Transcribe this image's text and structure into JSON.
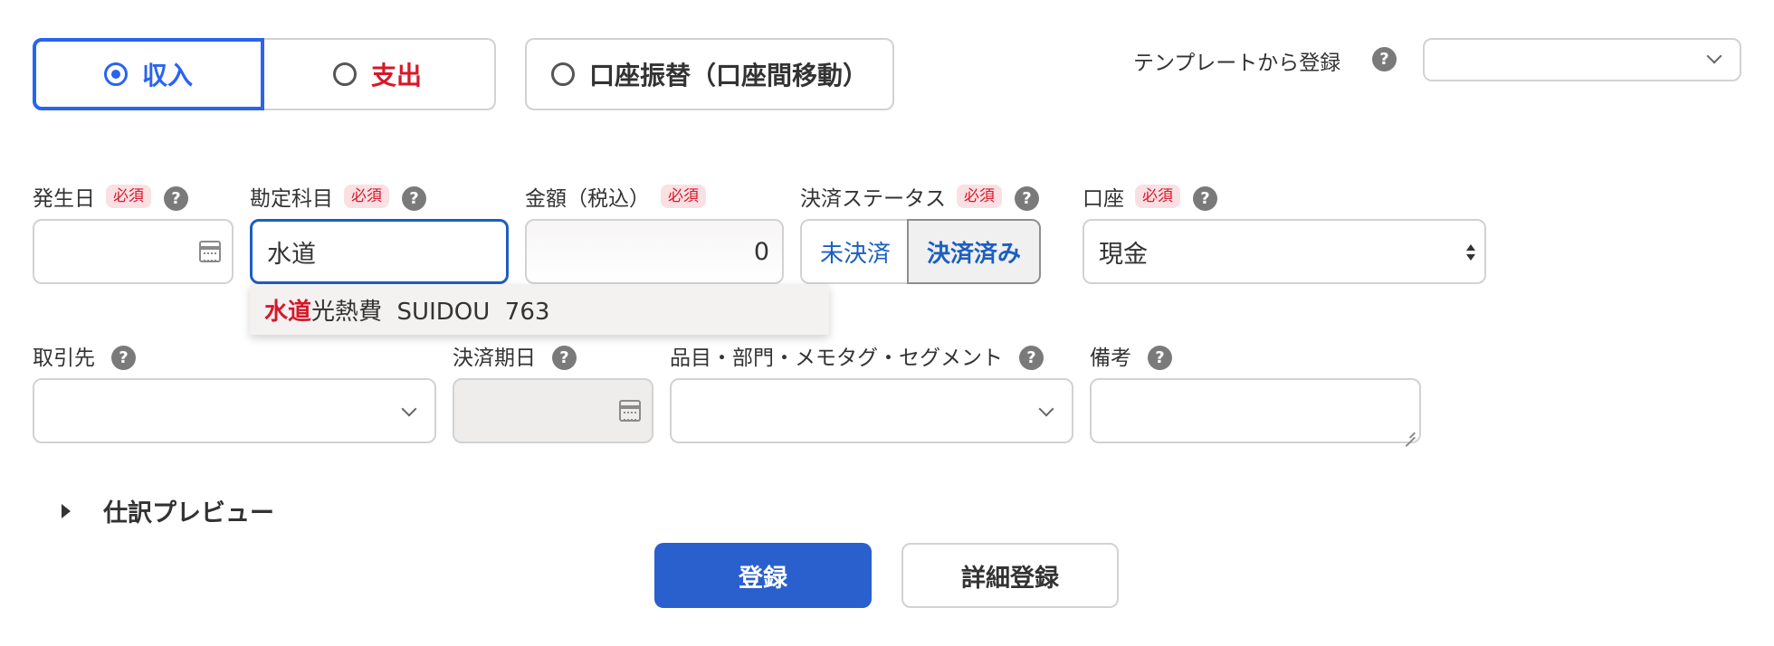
{
  "type_options": {
    "income": "収入",
    "expense": "支出",
    "transfer": "口座振替（口座間移動）",
    "selected": "income"
  },
  "template": {
    "label": "テンプレートから登録",
    "help": "?",
    "value": ""
  },
  "required_badge": "必須",
  "fields": {
    "date": {
      "label": "発生日",
      "value": ""
    },
    "account_item": {
      "label": "勘定科目",
      "value": "水道"
    },
    "amount": {
      "label": "金額（税込）",
      "value": "0"
    },
    "status": {
      "label": "決済ステータス",
      "unpaid": "未決済",
      "paid": "決済済み",
      "selected": "paid"
    },
    "wallet": {
      "label": "口座",
      "value": "現金"
    },
    "partner": {
      "label": "取引先",
      "value": ""
    },
    "due_date": {
      "label": "決済期日",
      "value": ""
    },
    "tags": {
      "label": "品目・部門・メモタグ・セグメント",
      "value": ""
    },
    "memo": {
      "label": "備考",
      "value": ""
    }
  },
  "suggestion": {
    "match": "水道",
    "rest": "光熱費  SUIDOU  763"
  },
  "preview_label": "仕訳プレビュー",
  "buttons": {
    "submit": "登録",
    "detail": "詳細登録"
  },
  "colors": {
    "primary": "#2a5fce",
    "selected_border": "#2864f0",
    "expense_red": "#d7182a",
    "required_bg": "#fbe0e3"
  }
}
